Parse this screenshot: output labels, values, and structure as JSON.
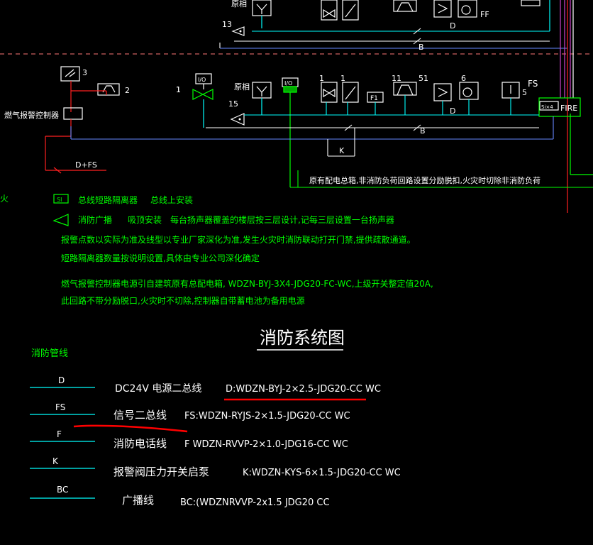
{
  "colors": {
    "background": "#000000",
    "line_white": "#ffffff",
    "line_cyan": "#00ffff",
    "line_green": "#00ff00",
    "line_red": "#ff2020",
    "line_magenta": "#cc44cc",
    "line_blue": "#6688ff",
    "text_green": "#00ff00",
    "text_white": "#ffffff",
    "annotation_red": "#ff0000"
  },
  "top_labels": {
    "count_13": "13",
    "top_cut_label": "原相",
    "ff_label": "FF",
    "bus_d_top": "D",
    "bus_b_top": "B"
  },
  "gas_section": {
    "count_3": "3",
    "count_2": "2",
    "count_1": "1",
    "controller_label": "燃气报警控制器",
    "d_fs_label": "D+FS"
  },
  "main_row": {
    "io_box_1": "I/O",
    "io_box_2": "I/O",
    "label_existing": "原相",
    "count_15": "15",
    "count_1a": "1",
    "count_1b": "1",
    "f1_box": "F1",
    "count_11": "11",
    "count_51": "51",
    "count_6": "6",
    "fs_label": "FS",
    "count_5": "5",
    "bus_d": "D",
    "bus_b": "B",
    "bus_k": "K",
    "si_box": "Si×4",
    "fire_label": "FIRE",
    "note_distribution": "原有配电总箱,非消防负荷回路设置分励脱扣,火灾时切除非消防负荷",
    "edge_char": "火"
  },
  "notes": {
    "si_symbol": "SI",
    "si_desc": "总线短路隔离器",
    "si_mount": "总线上安装",
    "broadcast_desc": "消防广播",
    "broadcast_mount": "吸顶安装",
    "broadcast_note": "每台扬声器覆盖的楼层按三层设计,记每三层设置一台扬声器",
    "line1": "报警点数以实际为准及线型以专业厂家深化为准,发生火灾时消防联动打开门禁,提供疏散通道。",
    "line2": "短路隔离器数量按说明设置,具体由专业公司深化确定",
    "line3": "燃气报警控制器电源引自建筑原有总配电箱, WDZN-BYJ-3X4-JDG20-FC-WC,上级开关整定值20A,",
    "line4": "此回路不带分励脱口,火灾时不切除,控制器自带蓄电池为备用电源"
  },
  "title": "消防系统图",
  "legend": {
    "header": "消防管线",
    "rows": [
      {
        "code": "D",
        "desc": "DC24V  电源二总线",
        "spec": "D:WDZN-BYJ-2×2.5-JDG20-CC WC"
      },
      {
        "code": "FS",
        "desc": "信号二总线",
        "spec": "FS:WDZN-RYJS-2×1.5-JDG20-CC WC"
      },
      {
        "code": "F",
        "desc": "消防电话线",
        "spec": "F WDZN-RVVP-2×1.0-JDG16-CC WC"
      },
      {
        "code": "K",
        "desc": "报警阀压力开关启泵",
        "spec": "K:WDZN-KYS-6×1.5-JDG20-CC WC"
      },
      {
        "code": "BC",
        "desc": "广播线",
        "spec": "BC:(WDZNRVVP-2x1.5 JDG20  CC"
      }
    ]
  }
}
